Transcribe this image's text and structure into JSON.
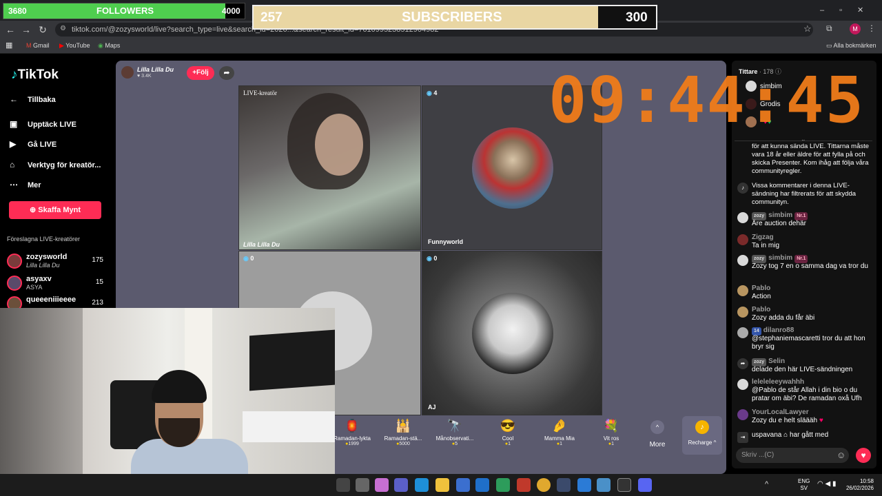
{
  "browser": {
    "url": "tiktok.com/@zozysworld/live?search_type=live&search_id=2026...&search_result_id=7610995238512904982",
    "bookmarks": [
      "Gmail",
      "YouTube",
      "Maps"
    ],
    "all_bookmarks": "Alla bokmärken",
    "profile_initial": "M"
  },
  "overlay": {
    "followers_current": "3680",
    "followers_label": "FOLLOWERS",
    "followers_goal": "4000",
    "followers_progress": 0.92,
    "subs_current": "257",
    "subs_label": "SUBSCRIBERS",
    "subs_goal": "300",
    "subs_progress": 0.857,
    "clock": "09:44:45"
  },
  "sidebar": {
    "logo": "TikTok",
    "back": "Tillbaka",
    "items": [
      {
        "label": "Upptäck LIVE",
        "icon": "calendar-icon"
      },
      {
        "label": "Gå LIVE",
        "icon": "camera-icon"
      },
      {
        "label": "Verktyg för kreatör...",
        "icon": "tools-icon"
      },
      {
        "label": "Mer",
        "icon": "more-icon"
      }
    ],
    "coins_button": "Skaffa Mynt",
    "suggested_heading": "Föreslagna LIVE-kreatörer",
    "suggested": [
      {
        "name": "zozysworld",
        "sub": "Lilla Lilla Du",
        "count": "175"
      },
      {
        "name": "asyaxv",
        "sub": "ASYA",
        "count": "15"
      },
      {
        "name": "queeeniiieeee",
        "sub": "",
        "count": "213"
      }
    ]
  },
  "live": {
    "host_name": "Lilla Lilla Du",
    "host_likes": "3.4K",
    "follow": "+Följ",
    "tiles": [
      {
        "label_top": "LIVE-kreatör",
        "label_bottom": "Lilla Lilla Du"
      },
      {
        "count": "4",
        "label_bottom": "Funnyworld"
      },
      {
        "count": "0",
        "label_bottom": ""
      },
      {
        "count": "0",
        "label_bottom": "AJ"
      }
    ]
  },
  "gifts": [
    {
      "name": "Ramadan-lykta",
      "price": "1999"
    },
    {
      "name": "Ramadan-stä...",
      "price": "5000"
    },
    {
      "name": "Månobservati...",
      "price": "5"
    },
    {
      "name": "Cool",
      "price": "1"
    },
    {
      "name": "Mamma Mia",
      "price": "1"
    },
    {
      "name": "Vit ros",
      "price": "1"
    }
  ],
  "gifts_more": "More",
  "recharge": "Recharge",
  "viewers": {
    "title": "Tittare",
    "count": "178",
    "top": [
      {
        "name": "simbim"
      },
      {
        "name": "Grodis"
      }
    ]
  },
  "chat": [
    {
      "name": "",
      "text": "för att kunna sända LIVE. Tittarna måste vara 18 år eller äldre för att fylla på och skicka Presenter. Kom ihåg att följa våra communityregler.",
      "tag": "",
      "rank": ""
    },
    {
      "name": "",
      "text": "Vissa kommentarer i denna LIVE-sändning har filtrerats för att skydda communityn.",
      "tag": "",
      "rank": ""
    },
    {
      "name": "simbim",
      "text": "Äre auction dehär",
      "tag": "zozy",
      "rank": "Nr.1"
    },
    {
      "name": "Zigzag",
      "text": "Ta in mig",
      "tag": "",
      "rank": ""
    },
    {
      "name": "simbim",
      "text": "Zozy tog 7 en o samma dag va tror du",
      "tag": "zozy",
      "rank": "Nr.1"
    },
    {
      "name": "Pablo",
      "text": "Action",
      "tag": "",
      "rank": ""
    },
    {
      "name": "Pablo",
      "text": "Zozy adda du får äbi",
      "tag": "",
      "rank": ""
    },
    {
      "name": "dilanro88",
      "text": "@stephaniemascaretti tror du att hon bryr sig",
      "tag": "14",
      "rank": ""
    },
    {
      "name": "Selin",
      "text": "delade den här LIVE-sändningen",
      "tag": "zozy",
      "rank": ""
    },
    {
      "name": "leleleleeywahhh",
      "text": "@Pablo de står Allah i din bio o du pratar om äbi? De ramadan oxå Ufh",
      "tag": "",
      "rank": ""
    },
    {
      "name": "YourLocalLawyer",
      "text": "Zozy du e helt släääh",
      "tag": "",
      "rank": ""
    },
    {
      "name": "uspavana",
      "text": "har gått med",
      "tag": "",
      "rank": ""
    }
  ],
  "chat_input_placeholder": "Skriv ...(C)",
  "taskbar": {
    "lang": "ENG",
    "lang2": "SV",
    "time": "10:58",
    "date": "26/02/2026"
  },
  "colors": {
    "accent": "#fe2c55",
    "followers_bar": "#4fce4f",
    "subs_bar": "#e9d6a3",
    "clock": "#f07c1a",
    "live_bg": "#5b5a6e"
  }
}
